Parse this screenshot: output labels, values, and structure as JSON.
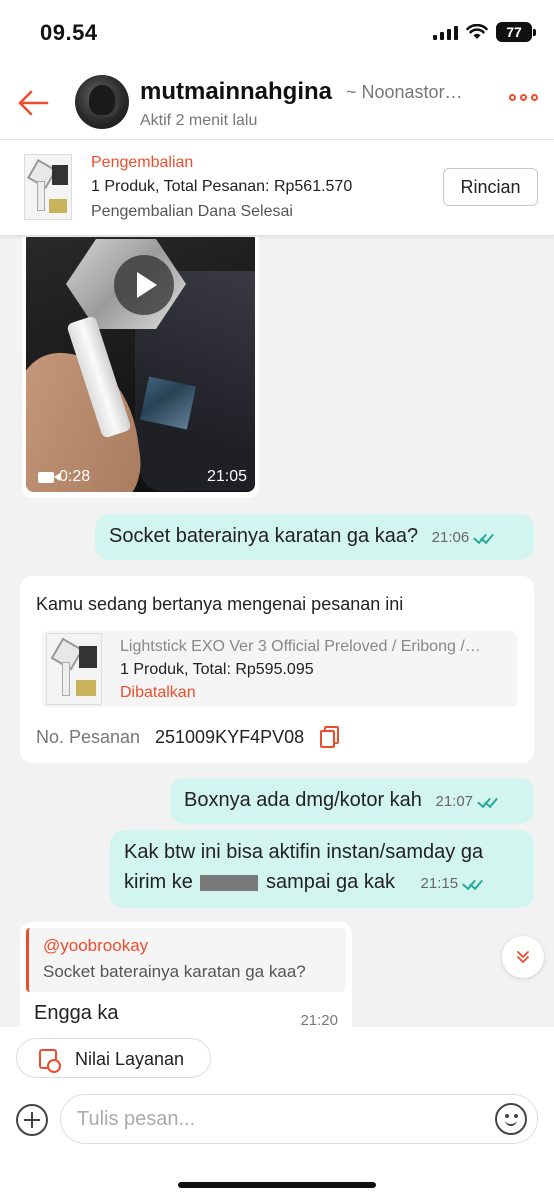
{
  "status_bar": {
    "time": "09.54",
    "battery": "77"
  },
  "header": {
    "username": "mutmainnahgina",
    "shop": "~ Noonastor…",
    "last_seen": "Aktif 2 menit lalu"
  },
  "order_banner": {
    "status": "Pengembalian",
    "summary": "1 Produk, Total Pesanan: Rp561.570",
    "refund": "Pengembalian Dana Selesai",
    "button": "Rincian"
  },
  "messages": {
    "video": {
      "duration": "0:28",
      "time": "21:05"
    },
    "out1": {
      "text": "Socket baterainya karatan ga kaa?",
      "time": "21:06"
    },
    "order_card": {
      "intro": "Kamu sedang bertanya mengenai pesanan ini",
      "product_title": "Lightstick EXO Ver 3 Official Preloved / Eribong /…",
      "total": "1 Produk, Total: Rp595.095",
      "status": "Dibatalkan",
      "order_no_label": "No. Pesanan",
      "order_no": "251009KYF4PV08"
    },
    "out2": {
      "text": "Boxnya ada dmg/kotor kah",
      "time": "21:07"
    },
    "out3": {
      "line1": "Kak btw ini bisa aktifin instan/samday ga",
      "line2_pre": "kirim ke",
      "line2_post": "sampai ga kak",
      "time": "21:15"
    },
    "in1": {
      "quote_user": "@yoobrookay",
      "quote_text": "Socket baterainya karatan ga kaa?",
      "text": "Engga ka",
      "time": "21:20"
    }
  },
  "bottom": {
    "rate_label": "Nilai Layanan",
    "input_placeholder": "Tulis pesan..."
  },
  "colors": {
    "accent": "#ee4d2d",
    "bubble_out": "#d3f5ef",
    "tick": "#26aa99"
  }
}
